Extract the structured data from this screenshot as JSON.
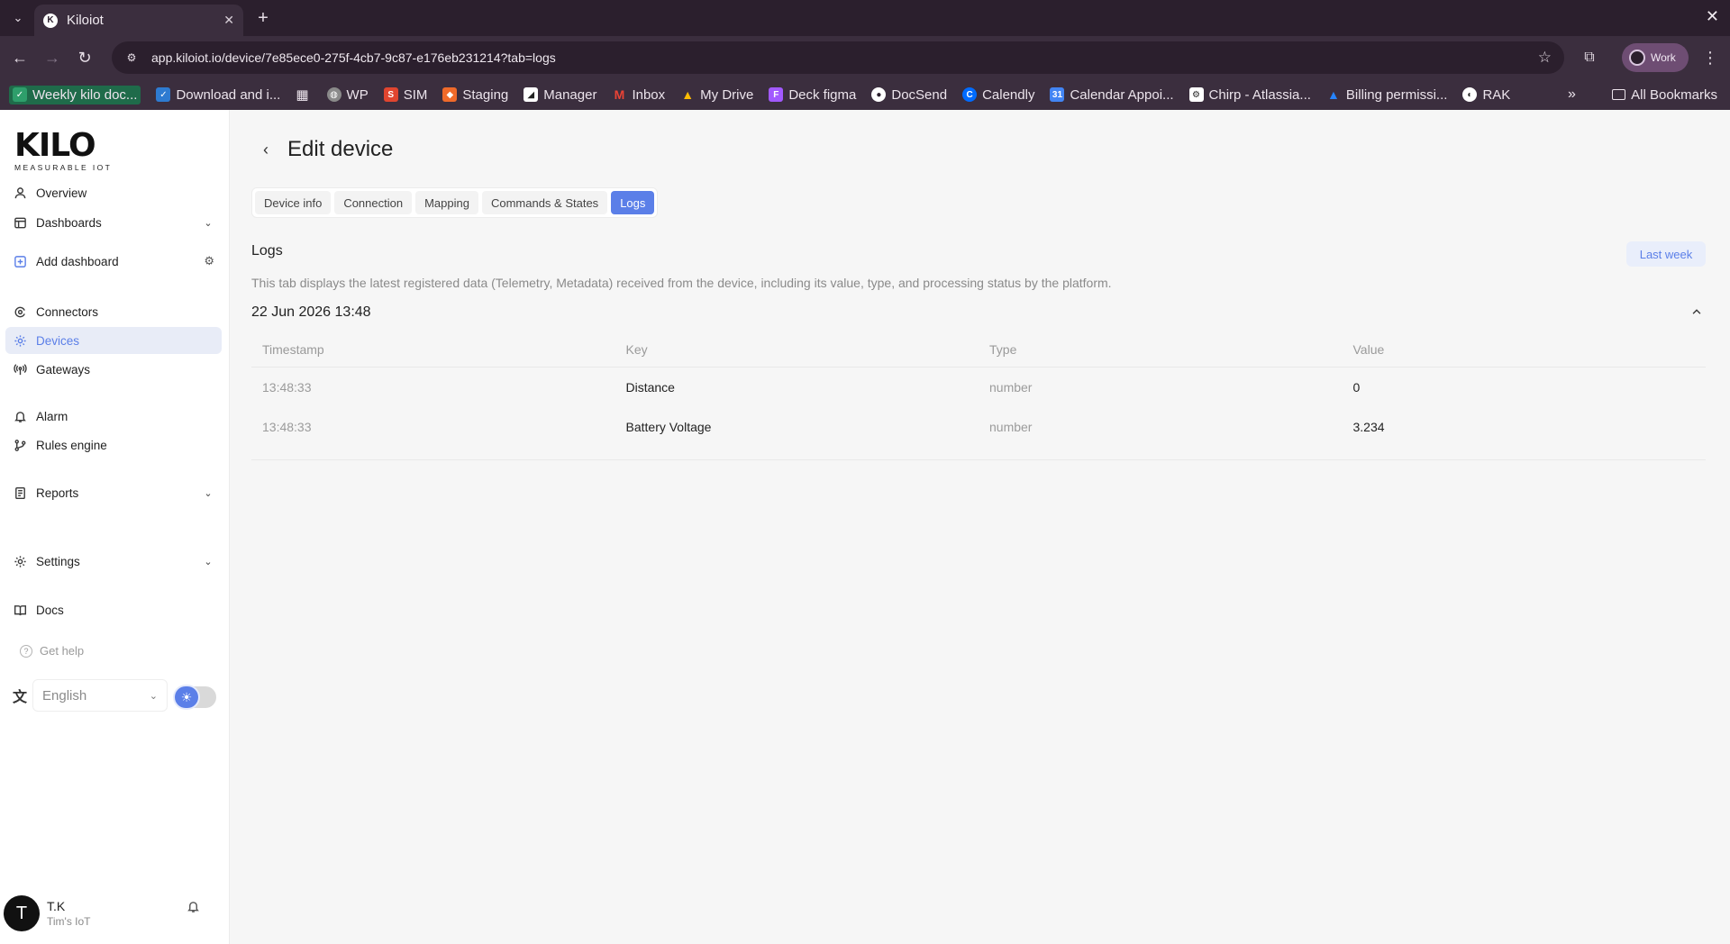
{
  "browser": {
    "tab_title": "Kiloiot",
    "url": "app.kiloiot.io/device/7e85ece0-275f-4cb7-9c87-e176eb231214?tab=logs",
    "profile_label": "Work",
    "bookmarks": [
      {
        "label": "Weekly kilo doc...",
        "color": "#2e9e6b"
      },
      {
        "label": "Download and i...",
        "color": "#2e7bd1"
      },
      {
        "label": "WP",
        "color": "#8a8a8a"
      },
      {
        "label": "SIM",
        "color": "#e0452f"
      },
      {
        "label": "Staging",
        "color": "#f06a2a"
      },
      {
        "label": "Manager",
        "color": "#222222"
      },
      {
        "label": "Inbox",
        "color": "#d93025"
      },
      {
        "label": "My Drive",
        "color": "#1fa463"
      },
      {
        "label": "Deck figma",
        "color": "#a259ff"
      },
      {
        "label": "DocSend",
        "color": "#ffffff"
      },
      {
        "label": "Calendly",
        "color": "#006bff"
      },
      {
        "label": "Calendar Appoi...",
        "color": "#4285f4"
      },
      {
        "label": "Chirp - Atlassia...",
        "color": "#ffffff"
      },
      {
        "label": "Billing permissi...",
        "color": "#2684ff"
      },
      {
        "label": "RAK",
        "color": "#ffffff"
      }
    ],
    "all_bookmarks": "All Bookmarks"
  },
  "sidebar": {
    "logo_main": "KILO",
    "logo_sub": "MEASURABLE IOT",
    "items": {
      "overview": "Overview",
      "dashboards": "Dashboards",
      "add_dashboard": "Add dashboard",
      "connectors": "Connectors",
      "devices": "Devices",
      "gateways": "Gateways",
      "alarm": "Alarm",
      "rules_engine": "Rules engine",
      "reports": "Reports",
      "settings": "Settings",
      "docs": "Docs"
    },
    "get_help": "Get help",
    "language": "English",
    "user": {
      "initial": "T",
      "name": "T.K",
      "org": "Tim's IoT"
    },
    "accent_color": "#5b7fe8"
  },
  "main": {
    "title": "Edit device",
    "tabs": [
      "Device info",
      "Connection",
      "Mapping",
      "Commands & States",
      "Logs"
    ],
    "active_tab": "Logs",
    "logs": {
      "title": "Logs",
      "range_button": "Last week",
      "description": "This tab displays the latest registered data (Telemetry, Metadata) received from the device, including its value, type, and processing status by the platform.",
      "group_date": "22 Jun 2026 13:48",
      "columns": [
        "Timestamp",
        "Key",
        "Type",
        "Value"
      ],
      "rows": [
        {
          "timestamp": "13:48:33",
          "key": "Distance",
          "type": "number",
          "value": "0"
        },
        {
          "timestamp": "13:48:33",
          "key": "Battery Voltage",
          "type": "number",
          "value": "3.234"
        }
      ]
    }
  }
}
